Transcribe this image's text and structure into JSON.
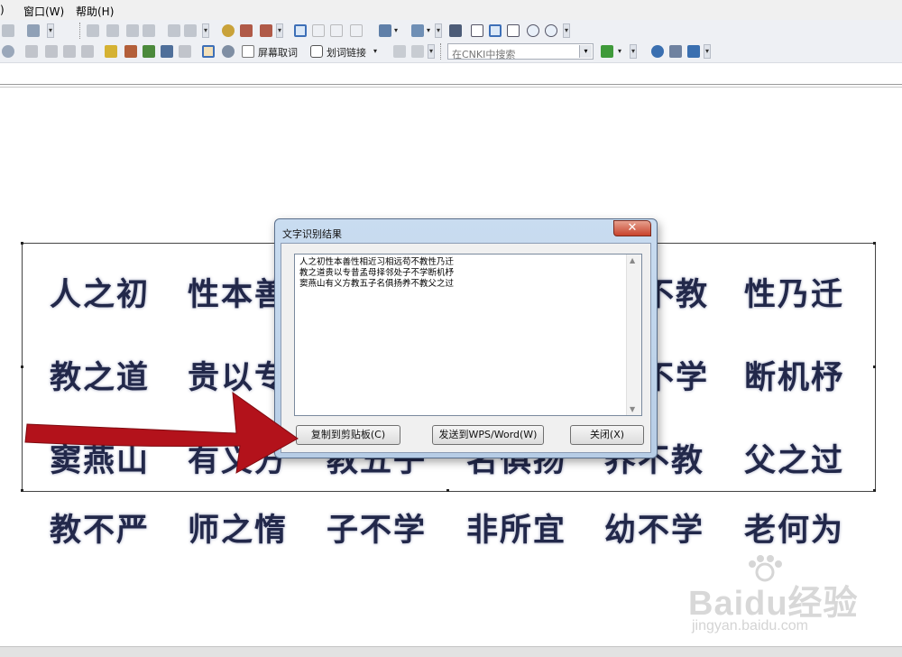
{
  "menu": {
    "edit_fragment": ")",
    "window": "窗口(W)",
    "help": "帮助(H)"
  },
  "toolbar2": {
    "screen_lookup": "屏幕取词",
    "phrase_link": "划词链接"
  },
  "search": {
    "placeholder": "在CNKI中搜索"
  },
  "document": {
    "rows": [
      [
        "人之初",
        "性本善",
        "",
        "",
        "不教",
        "性乃迁"
      ],
      [
        "教之道",
        "贵以专",
        "",
        "",
        "不学",
        "断机杼"
      ],
      [
        "窦燕山",
        "有义方",
        "教五子",
        "名俱扬",
        "养不教",
        "父之过"
      ],
      [
        "教不严",
        "师之惰",
        "子不学",
        "非所宜",
        "幼不学",
        "老何为"
      ]
    ]
  },
  "dialog": {
    "title": "文字识别结果",
    "close_glyph": "✕",
    "text_lines": [
      "人之初性本善性相近习相远苟不教性乃迁",
      "教之道贵以专昔孟母择邻处子不学断机杼",
      "窦燕山有义方教五子名俱扬养不教父之过"
    ],
    "buttons": {
      "copy": "复制到剪贴板(C)",
      "send": "发送到WPS/Word(W)",
      "close": "关闭(X)"
    }
  },
  "watermark": {
    "logo": "Baidu经验",
    "url": "jingyan.baidu.com"
  },
  "colors": {
    "arrow": "#b3121b",
    "dialog_frame": "#c9dcf0",
    "document_text": "#22284a"
  }
}
